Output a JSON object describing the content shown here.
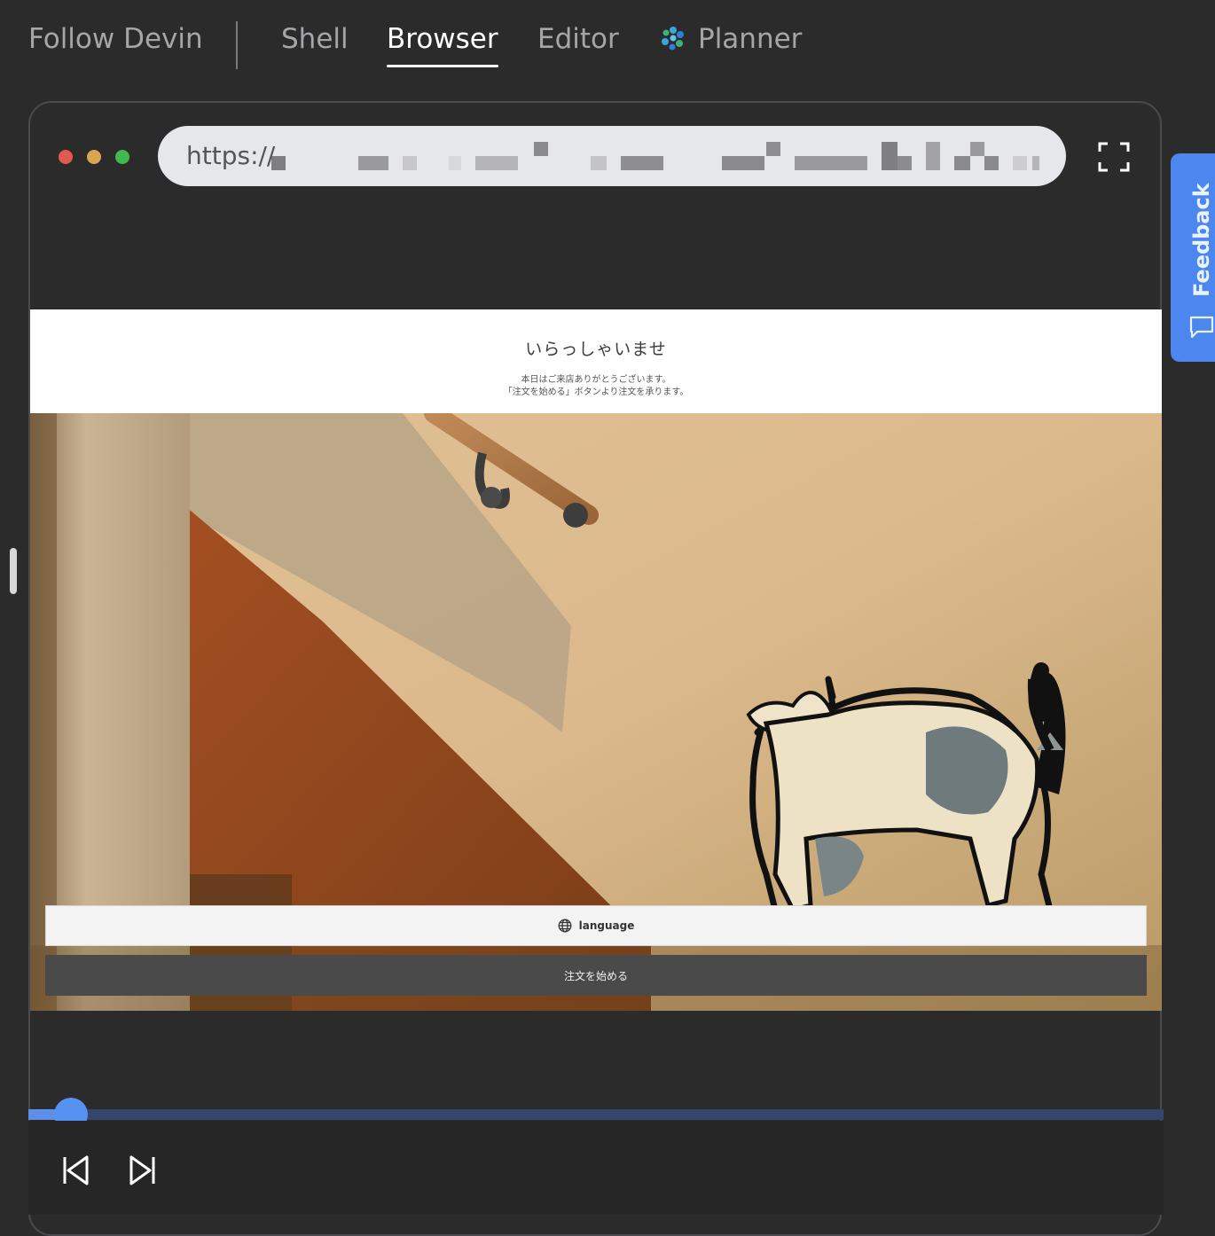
{
  "top_tabs": {
    "follow_devin": "Follow Devin",
    "shell": "Shell",
    "browser": "Browser",
    "editor": "Editor",
    "planner": "Planner",
    "active": "Browser"
  },
  "browser": {
    "url_prefix": "https://",
    "url_redacted": true,
    "window_controls": [
      "close",
      "minimize",
      "maximize"
    ],
    "fullscreen_icon": "expand-icon"
  },
  "webpage": {
    "title": "いらっしゃいませ",
    "subtitle_line1": "本日はご来店ありがとうございます。",
    "subtitle_line2": "「注文を始める」ボタンより注文を承ります。",
    "hero_image": "cat-illustration-on-wall-under-stair-handrail",
    "language_button": "language",
    "language_icon": "globe-icon",
    "order_button": "注文を始める"
  },
  "playback": {
    "progress_fraction": 0.037,
    "prev_icon": "skip-back-icon",
    "next_icon": "skip-forward-icon"
  },
  "feedback": {
    "label": "Feedback",
    "icon": "chat-bubble-icon"
  },
  "colors": {
    "background": "#2b2b2c",
    "accent_blue": "#4c86ef",
    "progress_track": "#34466a",
    "order_button": "#4a4a4a"
  }
}
